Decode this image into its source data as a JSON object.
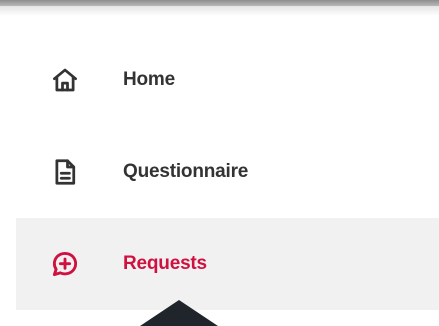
{
  "nav": {
    "items": [
      {
        "label": "Home",
        "icon": "home-icon",
        "active": false
      },
      {
        "label": "Questionnaire",
        "icon": "document-icon",
        "active": false
      },
      {
        "label": "Requests",
        "icon": "chat-plus-icon",
        "active": true
      }
    ]
  },
  "colors": {
    "active_text": "#cf1140",
    "text": "#333333",
    "active_background": "#f1f1f1",
    "pointer": "#1f252b"
  }
}
